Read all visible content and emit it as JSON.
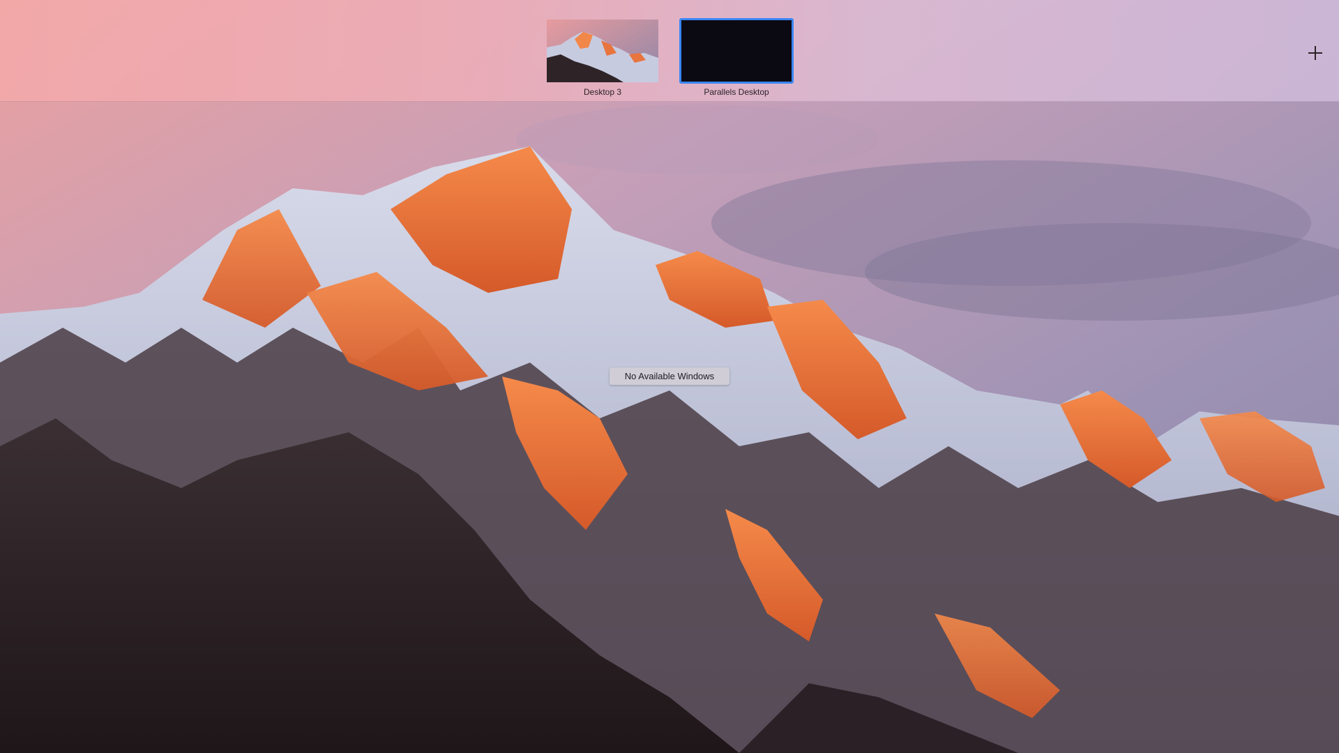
{
  "mission_control": {
    "spaces": [
      {
        "label": "Desktop 3"
      },
      {
        "label": "Parallels Desktop"
      }
    ],
    "add_space_icon": "plus-icon",
    "selected_space": "Parallels Desktop"
  },
  "main": {
    "empty_state": "No Available Windows"
  },
  "colors": {
    "selection_border": "#3a86f5",
    "parallels_thumbnail": "#0b0a12"
  }
}
